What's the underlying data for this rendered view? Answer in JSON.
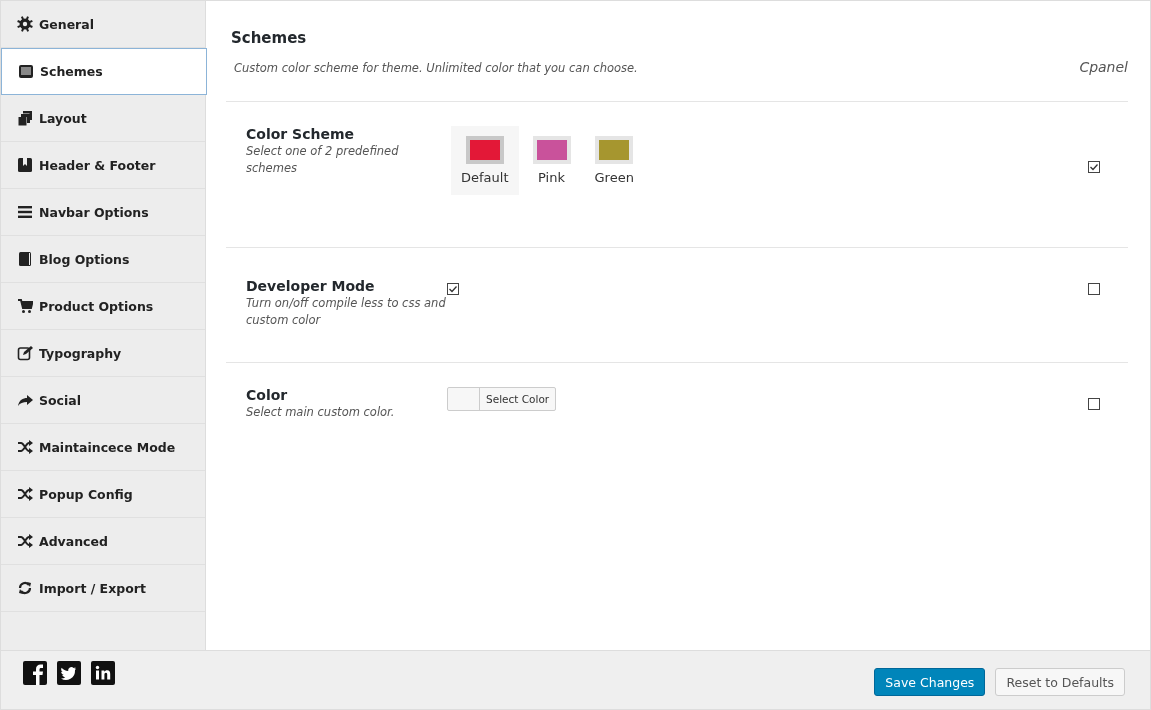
{
  "sidebar": {
    "items": [
      {
        "label": "General",
        "selected": false
      },
      {
        "label": "Schemes",
        "selected": true
      },
      {
        "label": "Layout",
        "selected": false
      },
      {
        "label": "Header & Footer",
        "selected": false
      },
      {
        "label": "Navbar Options",
        "selected": false
      },
      {
        "label": "Blog Options",
        "selected": false
      },
      {
        "label": "Product Options",
        "selected": false
      },
      {
        "label": "Typography",
        "selected": false
      },
      {
        "label": "Social",
        "selected": false
      },
      {
        "label": "Maintaincece Mode",
        "selected": false
      },
      {
        "label": "Popup Config",
        "selected": false
      },
      {
        "label": "Advanced",
        "selected": false
      },
      {
        "label": "Import / Export",
        "selected": false
      }
    ]
  },
  "page": {
    "title": "Schemes",
    "description": "Custom color scheme for theme. Unlimited color that you can choose.",
    "cpanel_label": "Cpanel"
  },
  "settings": [
    {
      "kind": "swatches",
      "title": "Color Scheme",
      "description": "Select one of 2 predefined schemes",
      "cpanel": true,
      "swatches": [
        {
          "label": "Default",
          "color": "#e31837",
          "selected": true
        },
        {
          "label": "Pink",
          "color": "#c9529b",
          "selected": false
        },
        {
          "label": "Green",
          "color": "#a6962f",
          "selected": false
        }
      ]
    },
    {
      "kind": "checkbox",
      "title": "Developer Mode",
      "description": "Turn on/off compile less to css and custom color",
      "cpanel": false,
      "checked": true
    },
    {
      "kind": "colorpicker",
      "title": "Color",
      "description": "Select main custom color.",
      "cpanel": false,
      "button": "Select Color"
    }
  ],
  "footer": {
    "buttons": [
      {
        "label": "Save Changes",
        "kind": "primary"
      },
      {
        "label": "Reset to Defaults",
        "kind": "secondary"
      }
    ]
  }
}
